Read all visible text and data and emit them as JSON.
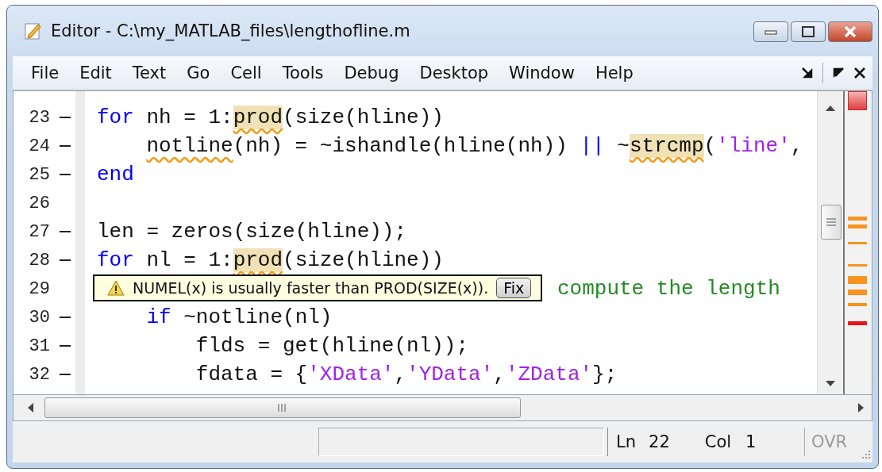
{
  "window": {
    "title": "Editor - C:\\my_MATLAB_files\\lengthofline.m"
  },
  "menu": [
    "File",
    "Edit",
    "Text",
    "Go",
    "Cell",
    "Tools",
    "Debug",
    "Desktop",
    "Window",
    "Help"
  ],
  "code_lines": [
    {
      "number": "23",
      "executable": true,
      "segments": [
        {
          "kind": "keyword",
          "text": "for"
        },
        {
          "kind": "text",
          "text": " nh = 1:"
        },
        {
          "kind": "highlight",
          "text": "prod"
        },
        {
          "kind": "text",
          "text": "(size(hline))"
        }
      ],
      "children": [
        {
          "number": "24",
          "executable": true,
          "segments": [
            {
              "kind": "squiggle",
              "text": "notline"
            },
            {
              "kind": "text",
              "text": "(nh) = ~ishandle(hline(nh)) "
            },
            {
              "kind": "keyword",
              "text": "||"
            },
            {
              "kind": "text",
              "text": " ~"
            },
            {
              "kind": "highlight",
              "text": "strcmp"
            },
            {
              "kind": "text",
              "text": "("
            },
            {
              "kind": "string",
              "text": "'line'"
            },
            {
              "kind": "text",
              "text": ","
            }
          ]
        }
      ]
    },
    {
      "number": "25",
      "executable": true,
      "segments": [
        {
          "kind": "keyword",
          "text": "end"
        }
      ]
    },
    {
      "number": "26",
      "executable": false
    },
    {
      "number": "27",
      "executable": true,
      "segments": [
        {
          "kind": "text",
          "text": "len = zeros(size(hline));"
        }
      ]
    },
    {
      "number": "28",
      "executable": true,
      "segments": [
        {
          "kind": "keyword",
          "text": "for"
        },
        {
          "kind": "text",
          "text": " nl = 1:"
        },
        {
          "kind": "highlight",
          "text": "prod"
        },
        {
          "kind": "text",
          "text": "(size(hline))"
        }
      ],
      "children": [
        {
          "number": "29",
          "executable": false,
          "covered": true,
          "segments": [
            {
              "kind": "comment",
              "text": "compute the length"
            }
          ]
        },
        {
          "number": "30",
          "executable": true,
          "segments": [
            {
              "kind": "keyword",
              "text": "if"
            },
            {
              "kind": "text",
              "text": " ~notline(nl)"
            }
          ],
          "children": [
            {
              "number": "31",
              "executable": true,
              "segments": [
                {
                  "kind": "text",
                  "text": "flds = get(hline(nl));"
                }
              ]
            },
            {
              "number": "32",
              "executable": true,
              "segments": [
                {
                  "kind": "text",
                  "text": "fdata = {"
                },
                {
                  "kind": "string",
                  "text": "'XData'"
                },
                {
                  "kind": "text",
                  "text": ","
                },
                {
                  "kind": "string",
                  "text": "'YData'"
                },
                {
                  "kind": "text",
                  "text": ","
                },
                {
                  "kind": "string",
                  "text": "'ZData'"
                },
                {
                  "kind": "text",
                  "text": "};"
                }
              ]
            }
          ]
        }
      ]
    }
  ],
  "tooltip": {
    "message": "NUMEL(x) is usually faster than PROD(SIZE(x)).",
    "button": "Fix"
  },
  "status_bar": {
    "line_label": "Ln",
    "line": "22",
    "col_label": "Col",
    "col": "1",
    "mode": "OVR",
    "mode_disabled": true
  }
}
